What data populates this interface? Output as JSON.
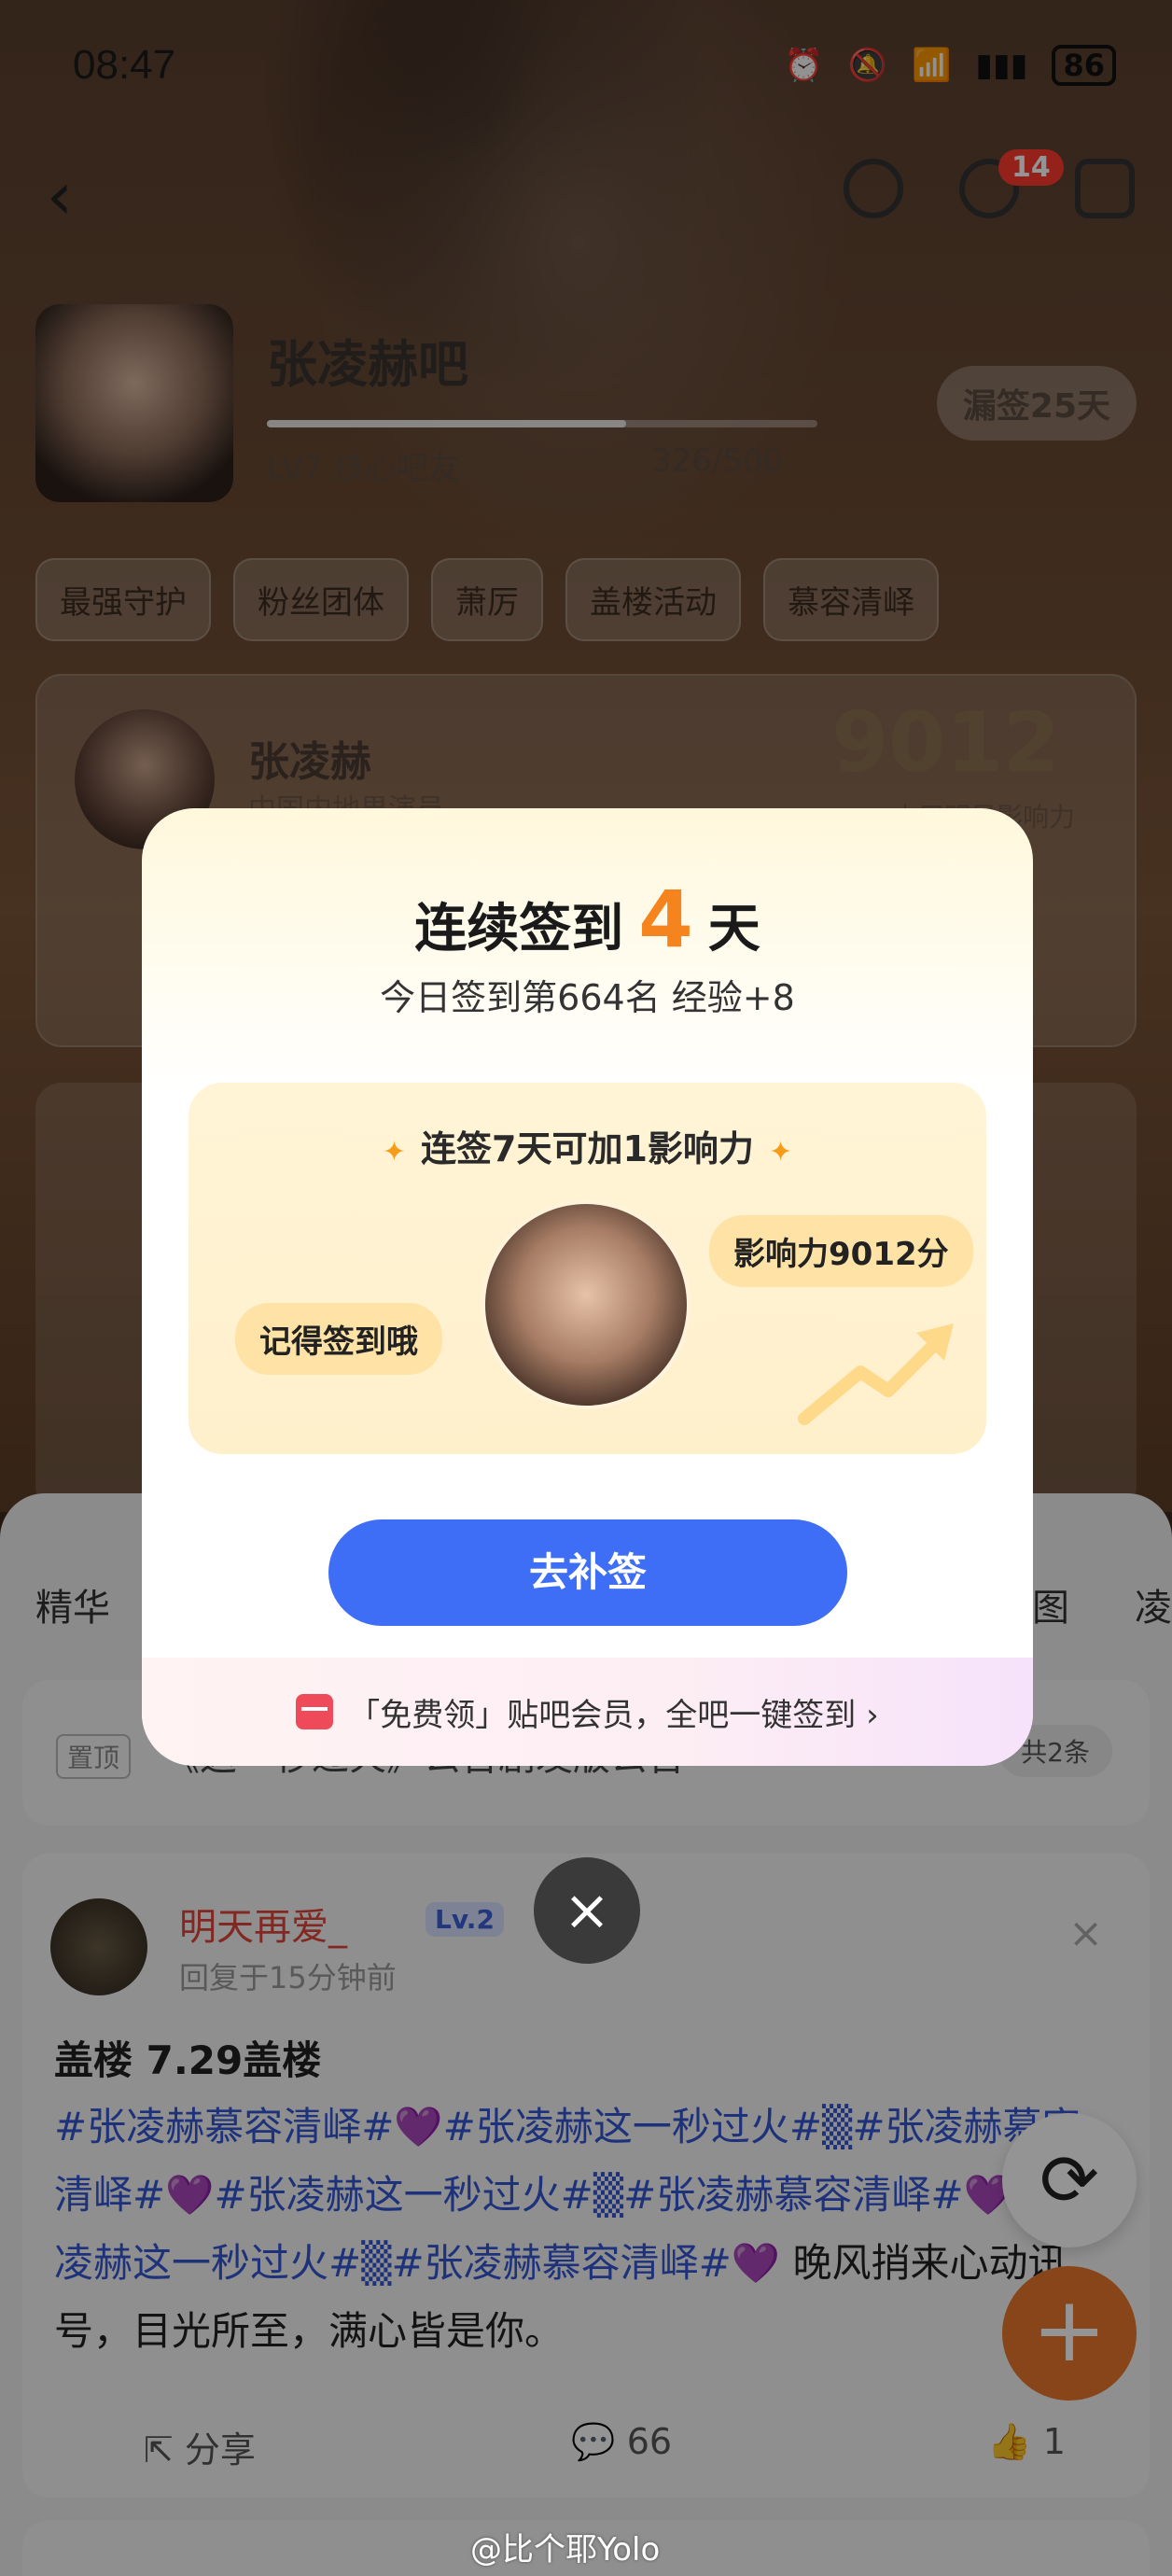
{
  "status": {
    "time": "08:47",
    "battery": "86"
  },
  "nav": {
    "message_badge": "14"
  },
  "forum": {
    "name": "张凌赫吧",
    "level_label": "LV7 核心吧友",
    "level_progress": "326/500",
    "level_fraction": 0.652,
    "leak_sign_button": "漏签25天"
  },
  "chips": [
    "最强守护",
    "粉丝团体",
    "萧厉",
    "盖楼活动",
    "慕容清峄"
  ],
  "star_card": {
    "name": "张凌赫",
    "subtitle": "中国内地男演员",
    "score": "9012",
    "score_label": "本周明星影响力"
  },
  "tabs": {
    "left": "精华",
    "right1": "图",
    "right2": "凌"
  },
  "pinned": {
    "tag": "置顶",
    "title": "《这一秒过火》公告剧发版公告",
    "count": "共2条"
  },
  "post": {
    "username": "明天再爱_",
    "level": "Lv.2",
    "time": "回复于15分钟前",
    "title": "盖楼  7.29盖楼",
    "body_tags": "#张凌赫慕容清峄#💜#张凌赫这一秒过火#▒#张凌赫慕容清峄#💜#张凌赫这一秒过火#▒#张凌赫慕容清峄#💜#张凌赫这一秒过火#▒#张凌赫慕容清峄#💜",
    "body_text": "晚风捎来心动讯号，目光所至，满心皆是你。",
    "share_label": "分享",
    "comment_count": "66",
    "like_count": "1"
  },
  "modal": {
    "title_prefix": "连续签到",
    "title_days": "4",
    "title_suffix": "天",
    "subtitle": "今日签到第664名 经验+8",
    "reward_title": "连签7天可加1影响力",
    "bubble_left": "记得签到哦",
    "bubble_right": "影响力9012分",
    "button": "去补签",
    "footer": "「免费领」贴吧会员，全吧一键签到 ›"
  },
  "watermark": "@比个耶Yolo",
  "colors": {
    "accent_blue": "#3d6ef5",
    "accent_orange": "#f5841f",
    "fab_orange": "#e9772b"
  }
}
